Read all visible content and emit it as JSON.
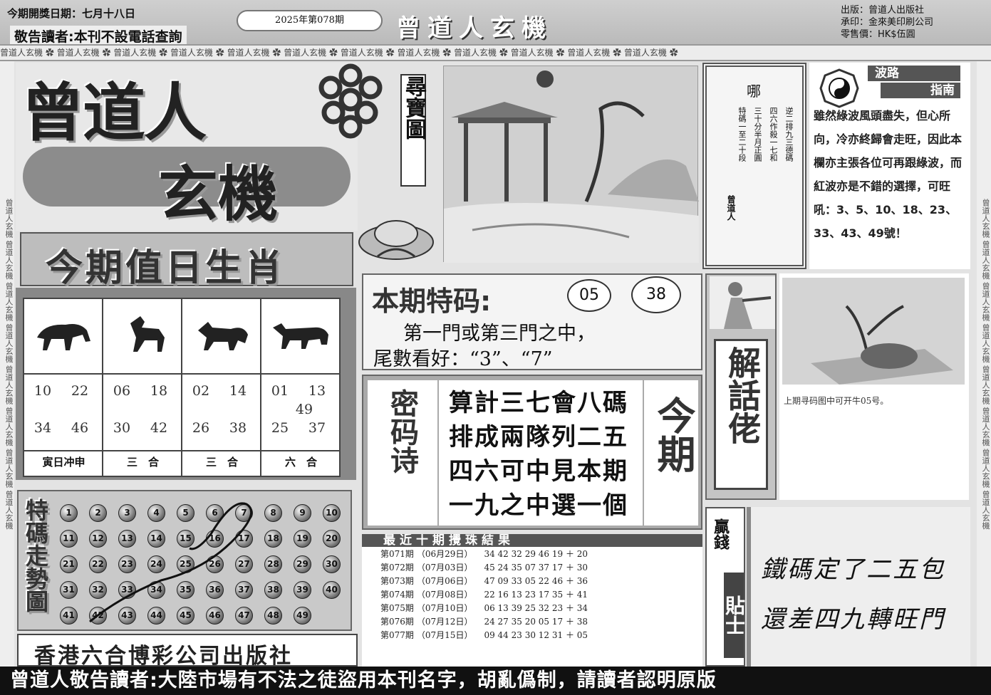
{
  "header": {
    "draw_date": "今期開獎日期：七月十八日",
    "notice": "敬告讀者:本刊不設電話查詢",
    "issue": "2025年第078期",
    "masthead": "曾道人玄機",
    "publisher": "出版：曾道人出版社",
    "printer": "承印：金來美印刷公司",
    "price": "零售價：HK$伍圓"
  },
  "pattern_text": "曾道人玄機 ✿ 曾道人玄機 ✿ 曾道人玄機 ✿ 曾道人玄機 ✿ 曾道人玄機 ✿ 曾道人玄機 ✿ 曾道人玄機 ✿ 曾道人玄機 ✿ 曾道人玄機 ✿ 曾道人玄機 ✿ 曾道人玄機 ✿ 曾道人玄機 ✿",
  "side_text": "曾道人玄機 曾道人玄機 曾道人玄機 曾道人玄機 曾道人玄機 曾道人玄機 曾道人玄機 曾道人玄機",
  "logo": {
    "line1": "曾道人",
    "line2": "玄機",
    "tag": "尋寶圖"
  },
  "zodiac": {
    "title": "今期值日生肖",
    "cols": [
      {
        "icon": "tiger-icon",
        "nums": [
          "10",
          "22",
          "34",
          "46"
        ],
        "note": "寅日冲申"
      },
      {
        "icon": "horse-icon",
        "nums": [
          "06",
          "18",
          "30",
          "42"
        ],
        "note": "三　合"
      },
      {
        "icon": "dog-icon",
        "nums": [
          "02",
          "14",
          "26",
          "38"
        ],
        "note": "三　合"
      },
      {
        "icon": "ox-icon",
        "nums": [
          "01",
          "13",
          "49",
          "25",
          "37"
        ],
        "note": "六　合"
      }
    ]
  },
  "trend": {
    "title": "特碼走勢圖",
    "balls": [
      "1",
      "2",
      "3",
      "4",
      "5",
      "6",
      "7",
      "8",
      "9",
      "10",
      "11",
      "12",
      "13",
      "14",
      "15",
      "16",
      "17",
      "18",
      "19",
      "20",
      "21",
      "22",
      "23",
      "24",
      "25",
      "26",
      "27",
      "28",
      "29",
      "30",
      "31",
      "32",
      "33",
      "34",
      "35",
      "36",
      "37",
      "38",
      "39",
      "40",
      "41",
      "42",
      "43",
      "44",
      "45",
      "46",
      "47",
      "48",
      "49"
    ]
  },
  "hk_publisher": "香港六合博彩公司出版社",
  "poem": {
    "title": "哪",
    "lines": [
      "逆二排九三德碼",
      "四六作殺一七和",
      "三十分半月正圓",
      "特碼一至二十段"
    ],
    "signature": "曾道人"
  },
  "guide": {
    "title1": "波路",
    "title2": "指南",
    "text": "雖然綠波風頭盡失，但心所向，冷亦終歸會走旺，因此本欄亦主張各位可再跟綠波，而紅波亦是不錯的選擇，可旺吼：3、5、10、18、23、33、43、49號！"
  },
  "special": {
    "label": "本期特码:",
    "n1": "05",
    "n2": "38",
    "line1": "第一門或第三門之中，",
    "line2": "尾數看好：“3”、“7”"
  },
  "secret": {
    "title": "密码诗",
    "lines": [
      "算計三七會八碼",
      "排成兩隊列二五",
      "四六可中見本期",
      "一九之中選一個"
    ],
    "side": "今期"
  },
  "jiehua": {
    "title": "解話佬",
    "caption": "上期寻码图中可开牛05号。"
  },
  "results": {
    "title": "最近十期攪珠結果",
    "rows": [
      [
        "第071期",
        "（06月29日）",
        "34 42 32 29 46 19 ＋ 20"
      ],
      [
        "第072期",
        "（07月03日）",
        "45 24 35 07 37 17 ＋ 30"
      ],
      [
        "第073期",
        "（07月06日）",
        "47 09 33 05 22 46 ＋ 36"
      ],
      [
        "第074期",
        "（07月08日）",
        "22 16 13 23 17 35 ＋ 41"
      ],
      [
        "第075期",
        "（07月10日）",
        "06 13 39 25 32 23 ＋ 34"
      ],
      [
        "第076期",
        "（07月12日）",
        "24 27 35 20 05 17 ＋ 38"
      ],
      [
        "第077期",
        "（07月15日）",
        "09 44 23 30 12 31 ＋ 05"
      ]
    ]
  },
  "tips": {
    "label1": "贏錢",
    "label2": "貼士",
    "line1": "鐵碼定了二五包",
    "line2": "還差四九轉旺門"
  },
  "footer": "曾道人敬告讀者:大陸市場有不法之徒盜用本刊名字，胡亂僞制，請讀者認明原版"
}
